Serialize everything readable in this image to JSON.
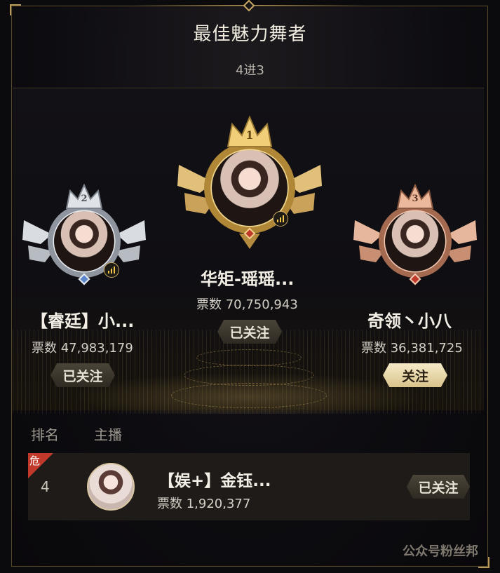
{
  "header": {
    "title": "最佳魅力舞者",
    "subtitle": "4进3"
  },
  "podium": [
    {
      "rank": "1",
      "name": "华矩-瑶瑶...",
      "votes": "票数 70,750,943",
      "follow_label": "已关注",
      "followed": true
    },
    {
      "rank": "2",
      "name": "【睿廷】小...",
      "votes": "票数 47,983,179",
      "follow_label": "已关注",
      "followed": true
    },
    {
      "rank": "3",
      "name": "奇领丶小八",
      "votes": "票数 36,381,725",
      "follow_label": "关注",
      "followed": false
    }
  ],
  "list": {
    "col_rank": "排名",
    "col_anchor": "主播",
    "rows": [
      {
        "danger": "危",
        "rank": "4",
        "name": "【娱+】金钰...",
        "votes": "票数 1,920,377",
        "follow_label": "已关注"
      }
    ]
  },
  "watermarks": {
    "main": "公众号粉丝邦"
  },
  "colors": {
    "gold": "#c9a961",
    "silver": "#c8ccd2",
    "bronze": "#d7a48a",
    "danger": "#c0392b"
  }
}
